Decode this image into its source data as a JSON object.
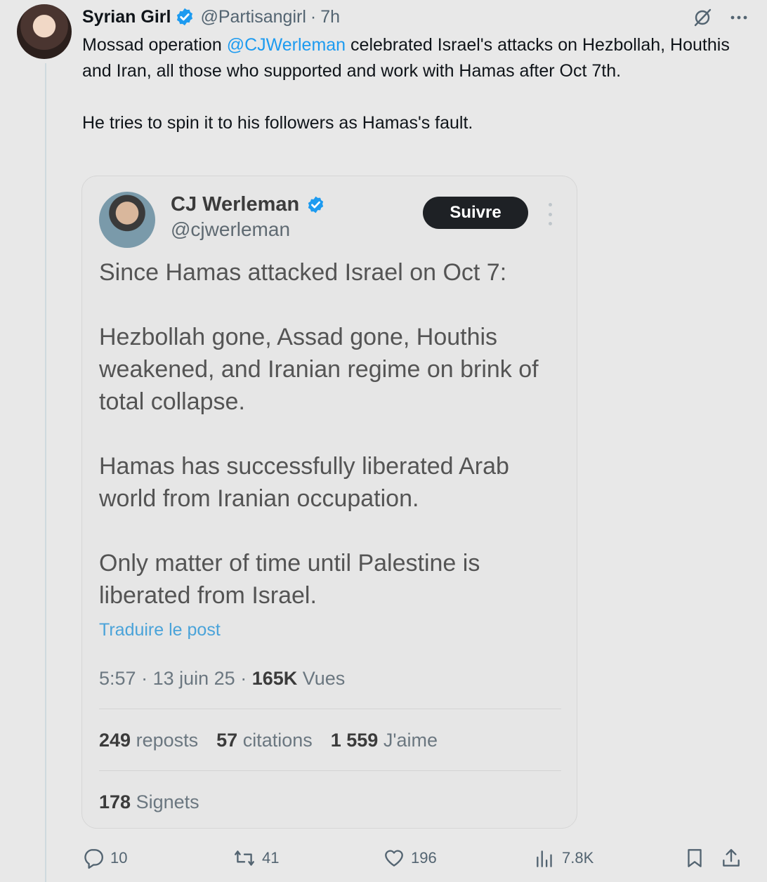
{
  "tweet": {
    "display_name": "Syrian Girl",
    "handle": "@Partisangirl",
    "separator": "·",
    "time": "7h",
    "text_part1": "Mossad operation ",
    "mention": "@CJWerleman",
    "text_part2": "  celebrated Israel's attacks on  Hezbollah, Houthis and Iran, all those who supported and work with Hamas after Oct 7th.",
    "text_para2": "He tries to spin it to his followers as Hamas's fault."
  },
  "quote": {
    "display_name": "CJ Werleman",
    "handle": "@cjwerleman",
    "follow_label": "Suivre",
    "para1": "Since Hamas attacked Israel on Oct 7:",
    "para2": "Hezbollah gone, Assad gone, Houthis weakened, and Iranian regime on brink of total collapse.",
    "para3": "Hamas has successfully liberated Arab world from Iranian occupation.",
    "para4": "Only matter of time until Palestine is liberated from Israel.",
    "translate": "Traduire le post",
    "time": "5:57",
    "date": "13 juin 25",
    "views_count": "165K",
    "views_label": "Vues",
    "reposts_count": "249",
    "reposts_label": "reposts",
    "quotes_count": "57",
    "quotes_label": "citations",
    "likes_count": "1 559",
    "likes_label": "J'aime",
    "bookmarks_count": "178",
    "bookmarks_label": "Signets"
  },
  "actions": {
    "replies": "10",
    "reposts": "41",
    "likes": "196",
    "views": "7.8K"
  },
  "colors": {
    "accent": "#1d9bf0",
    "background": "#e8e8e8",
    "follow_button": "#1e2125"
  }
}
